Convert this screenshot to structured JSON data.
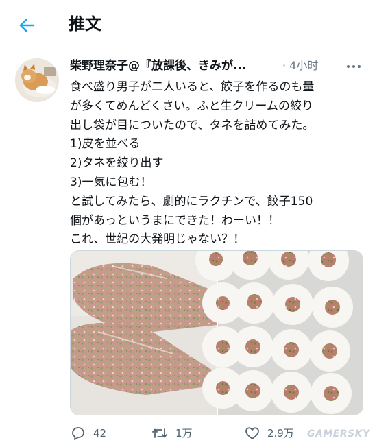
{
  "header": {
    "title": "推文",
    "back_icon": "arrow-left-icon",
    "accent": "#1da1f2"
  },
  "tweet": {
    "author_display": "柴野理奈子@『放課後、きみが...",
    "timestamp": "· 4小时",
    "more_icon": "more-dots-icon",
    "text_lines": [
      "食べ盛り男子が二人いると、餃子を作るのも量",
      "が多くてめんどくさい。ふと生クリームの絞り",
      "出し袋が目についたので、タネを詰めてみた。",
      "1)皮を並べる",
      "2)タネを絞り出す",
      "3)一気に包む！",
      "と試してみたら、劇的にラクチンで、餃子150",
      "個があっというまにできた！わーい！！",
      "これ、世紀の大発明じゃない？！"
    ],
    "media_left_alt": "piping bags filled with dumpling filling",
    "media_right_alt": "dumpling wrappers with filling",
    "actions": {
      "reply": {
        "icon": "reply-icon",
        "count": "42"
      },
      "retweet": {
        "icon": "retweet-icon",
        "count": "1万"
      },
      "like": {
        "icon": "heart-icon",
        "count": "2.9万"
      }
    }
  },
  "watermark": "GAMERSKY",
  "colors": {
    "text": "#0f1419",
    "secondary": "#657786",
    "border": "#e6ecf0"
  }
}
